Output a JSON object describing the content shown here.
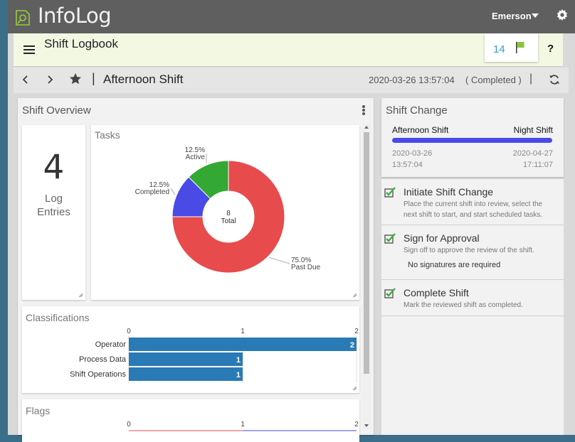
{
  "app": {
    "title": "InfoLog",
    "user": "Emerson"
  },
  "logbook": {
    "title": "Shift Logbook",
    "flag_count": "14",
    "help_label": "?"
  },
  "nav": {
    "separator": "|",
    "shift_title": "Afternoon Shift",
    "date": "2020-03-26 13:57:04",
    "status": "( Completed )",
    "separator2": "|"
  },
  "overview": {
    "title": "Shift Overview",
    "log_count": "4",
    "log_label_1": "Log",
    "log_label_2": "Entries",
    "tasks_title": "Tasks",
    "classifications_title": "Classifications",
    "flags_title": "Flags"
  },
  "chart_data": [
    {
      "type": "pie",
      "title": "Tasks",
      "center_value": "8",
      "center_label": "Total",
      "slices": [
        {
          "name": "Past Due",
          "value": 6,
          "percent_label": "75.0%",
          "color": "#e84b4b"
        },
        {
          "name": "Completed",
          "value": 1,
          "percent_label": "12.5%",
          "color": "#4a4ae6"
        },
        {
          "name": "Active",
          "value": 1,
          "percent_label": "12.5%",
          "color": "#33a833"
        }
      ]
    },
    {
      "type": "bar",
      "title": "Classifications",
      "orientation": "horizontal",
      "categories": [
        "Operator",
        "Process Data",
        "Shift Operations"
      ],
      "values": [
        2,
        1,
        1
      ],
      "xlim": [
        0,
        2
      ],
      "ticks": [
        "0",
        "1",
        "2"
      ],
      "color": "#2a7ab5"
    },
    {
      "type": "bar",
      "title": "Flags",
      "orientation": "horizontal",
      "xlim": [
        0,
        2
      ],
      "ticks": [
        "0",
        "1",
        "2"
      ]
    }
  ],
  "shift_change": {
    "title": "Shift Change",
    "from": "Afternoon Shift",
    "to": "Night Shift",
    "from_date": "2020-03-26",
    "from_time": "13:57:04",
    "to_date": "2020-04-27",
    "to_time": "17:11:07",
    "bar_color": "#4a4ae6"
  },
  "steps": [
    {
      "title": "Initiate Shift Change",
      "desc_1": "Place the current shift into review, select the",
      "desc_2": "next shift to start, and start scheduled tasks."
    },
    {
      "title": "Sign for Approval",
      "desc_1": "Sign off to approve the review of the shift.",
      "note": "No signatures are required"
    },
    {
      "title": "Complete Shift",
      "desc_1": "Mark the reviewed shift as completed."
    }
  ]
}
